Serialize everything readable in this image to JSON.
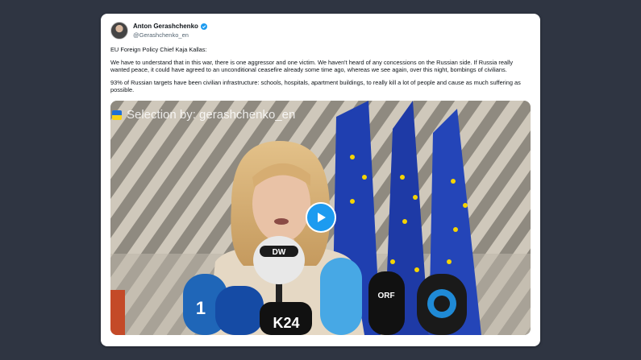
{
  "tweet": {
    "author": {
      "display_name": "Anton Gerashchenko",
      "handle": "@Gerashchenko_en",
      "verified": true
    },
    "paragraphs": [
      "EU Foreign Policy Chief Kaja Kallas:",
      "We have to understand that in this war, there is one aggressor and one victim. We haven't heard of any concessions on the Russian side. If Russia really wanted peace, it could have agreed to an unconditional ceasefire already some time ago, whereas we see again, over this night, bombings of civilians.",
      "93% of Russian targets have been civilian infrastructure: schools, hospitals, apartment buildings, to really kill a lot of people and cause as much suffering as possible."
    ]
  },
  "video": {
    "watermark": "Selection by: gerashchenko_en",
    "mic_labels": [
      "DW",
      "1",
      "K24",
      "ORF"
    ],
    "play_icon": "play-icon"
  },
  "colors": {
    "accent": "#1d9bf0",
    "background": "#2f3542",
    "eu_blue": "#1f3fb0",
    "eu_gold": "#f5d400"
  }
}
